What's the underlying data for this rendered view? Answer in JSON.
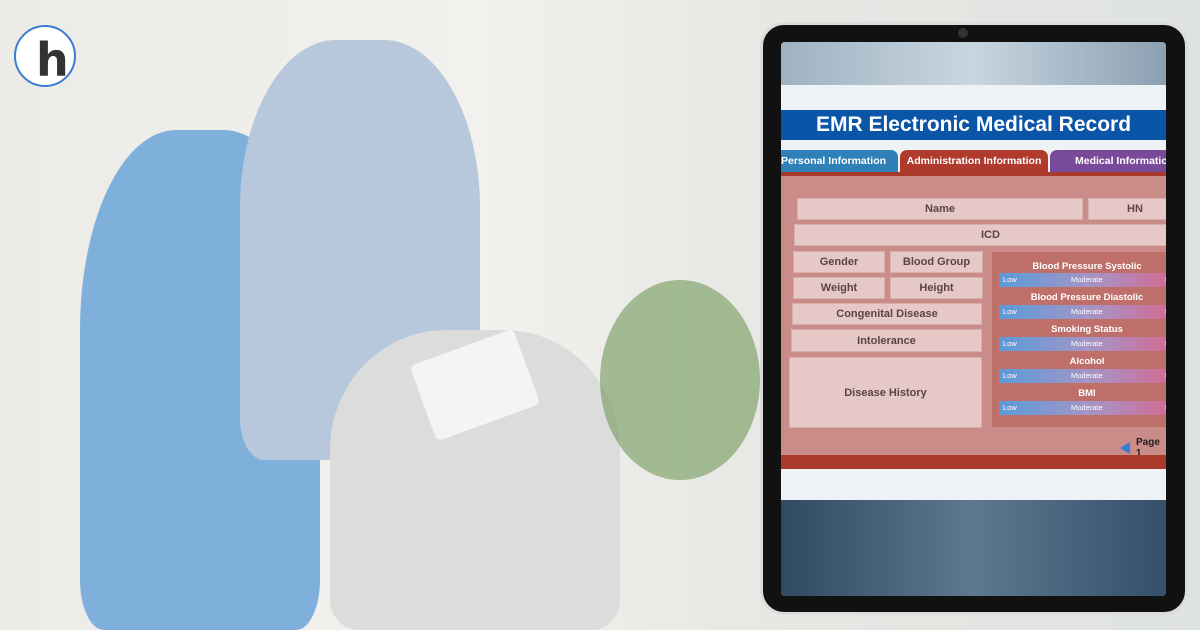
{
  "logo": {
    "letter": "h",
    "name": "logo-icon"
  },
  "emr": {
    "title": "EMR Electronic Medical Record",
    "tabs": [
      {
        "label": "Personal Information",
        "color": "#2f7fb8"
      },
      {
        "label": "Administration Information",
        "color": "#b03a2e",
        "active": true
      },
      {
        "label": "Medical  Information",
        "color": "#7a4a9a"
      }
    ],
    "fields": {
      "name": "Name",
      "hn": "HN",
      "icd": "ICD",
      "gender": "Gender",
      "blood_group": "Blood Group",
      "weight": "Weight",
      "height": "Height",
      "congenital": "Congenital Disease",
      "intolerance": "Intolerance",
      "history": "Disease History"
    },
    "metrics": [
      {
        "label": "Blood Pressure Systolic"
      },
      {
        "label": "Blood Pressure Diastolic"
      },
      {
        "label": "Smoking Status"
      },
      {
        "label": "Alcohol"
      },
      {
        "label": "BMI"
      }
    ],
    "scale": {
      "low": "Low",
      "moderate": "Moderate",
      "high": "Hi"
    },
    "page": "Page 1"
  },
  "colors": {
    "header": "#0b55a8",
    "accent": "#b03a2e"
  }
}
